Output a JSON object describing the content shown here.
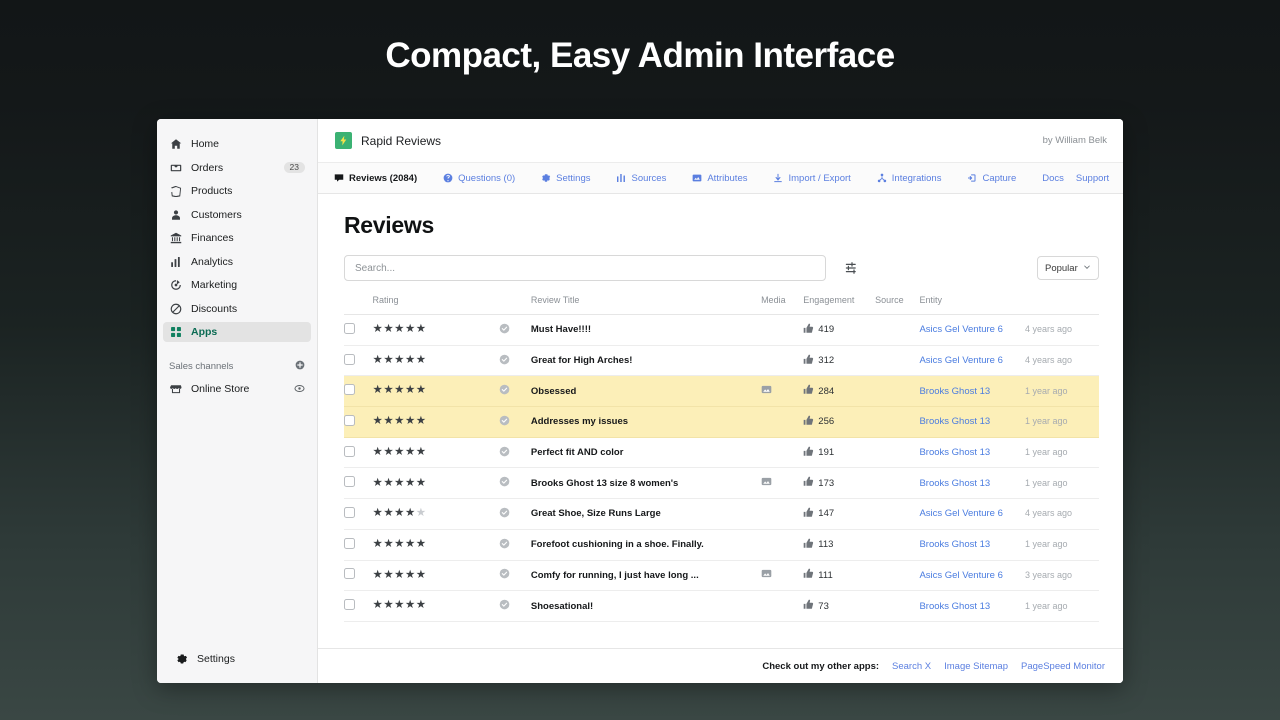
{
  "banner": {
    "title": "Compact, Easy Admin Interface"
  },
  "theme": {
    "accent_green": "#108060",
    "link_blue": "#5b7fe0",
    "highlight_row": "#fcefb8",
    "sidebar_bg": "#f6f6f7",
    "page_bg_top": "#121617",
    "page_bg_bottom": "#3a4744"
  },
  "sidebar": {
    "items": [
      {
        "label": "Home",
        "icon": "home-icon",
        "badge": "",
        "active": false
      },
      {
        "label": "Orders",
        "icon": "orders-icon",
        "badge": "23",
        "active": false
      },
      {
        "label": "Products",
        "icon": "products-icon",
        "badge": "",
        "active": false
      },
      {
        "label": "Customers",
        "icon": "customers-icon",
        "badge": "",
        "active": false
      },
      {
        "label": "Finances",
        "icon": "finances-icon",
        "badge": "",
        "active": false
      },
      {
        "label": "Analytics",
        "icon": "analytics-icon",
        "badge": "",
        "active": false
      },
      {
        "label": "Marketing",
        "icon": "marketing-icon",
        "badge": "",
        "active": false
      },
      {
        "label": "Discounts",
        "icon": "discounts-icon",
        "badge": "",
        "active": false
      },
      {
        "label": "Apps",
        "icon": "apps-icon",
        "badge": "",
        "active": true
      }
    ],
    "sales_channels_label": "Sales channels",
    "online_store_label": "Online Store",
    "settings_label": "Settings"
  },
  "topbar": {
    "app_name": "Rapid Reviews",
    "byline": "by William Belk"
  },
  "tabs": [
    {
      "label": "Reviews (2084)",
      "icon": "reviews-icon",
      "active": true
    },
    {
      "label": "Questions (0)",
      "icon": "question-icon",
      "active": false
    },
    {
      "label": "Settings",
      "icon": "gear-icon",
      "active": false
    },
    {
      "label": "Sources",
      "icon": "sources-icon",
      "active": false
    },
    {
      "label": "Attributes",
      "icon": "attributes-icon",
      "active": false
    },
    {
      "label": "Import / Export",
      "icon": "download-icon",
      "active": false
    },
    {
      "label": "Integrations",
      "icon": "integrations-icon",
      "active": false
    },
    {
      "label": "Capture",
      "icon": "capture-icon",
      "active": false
    },
    {
      "label": "Docs",
      "icon": "",
      "active": false
    },
    {
      "label": "Support",
      "icon": "",
      "active": false
    }
  ],
  "main": {
    "page_title": "Reviews",
    "search": {
      "value": "",
      "placeholder": "Search..."
    },
    "sort": {
      "selected": "Popular"
    },
    "table": {
      "headers": [
        "",
        "Rating",
        "",
        "Review Title",
        "Media",
        "Engagement",
        "Source",
        "Entity",
        ""
      ],
      "rows": [
        {
          "rating": 5,
          "verified": true,
          "title": "Must Have!!!!",
          "media": false,
          "engagement": "419",
          "source": "",
          "entity": "Asics Gel Venture 6",
          "time": "4 years ago",
          "highlighted": false
        },
        {
          "rating": 5,
          "verified": true,
          "title": "Great for High Arches!",
          "media": false,
          "engagement": "312",
          "source": "",
          "entity": "Asics Gel Venture 6",
          "time": "4 years ago",
          "highlighted": false
        },
        {
          "rating": 5,
          "verified": true,
          "title": "Obsessed",
          "media": true,
          "engagement": "284",
          "source": "",
          "entity": "Brooks Ghost 13",
          "time": "1 year ago",
          "highlighted": true
        },
        {
          "rating": 5,
          "verified": true,
          "title": "Addresses my issues",
          "media": false,
          "engagement": "256",
          "source": "",
          "entity": "Brooks Ghost 13",
          "time": "1 year ago",
          "highlighted": true
        },
        {
          "rating": 5,
          "verified": true,
          "title": "Perfect fit AND color",
          "media": false,
          "engagement": "191",
          "source": "",
          "entity": "Brooks Ghost 13",
          "time": "1 year ago",
          "highlighted": false
        },
        {
          "rating": 5,
          "verified": true,
          "title": "Brooks Ghost 13 size 8 women's",
          "media": true,
          "engagement": "173",
          "source": "",
          "entity": "Brooks Ghost 13",
          "time": "1 year ago",
          "highlighted": false
        },
        {
          "rating": 4,
          "verified": true,
          "title": "Great Shoe, Size Runs Large",
          "media": false,
          "engagement": "147",
          "source": "",
          "entity": "Asics Gel Venture 6",
          "time": "4 years ago",
          "highlighted": false
        },
        {
          "rating": 5,
          "verified": true,
          "title": "Forefoot cushioning in a shoe. Finally.",
          "media": false,
          "engagement": "113",
          "source": "",
          "entity": "Brooks Ghost 13",
          "time": "1 year ago",
          "highlighted": false
        },
        {
          "rating": 5,
          "verified": true,
          "title": "Comfy for running, I just have long ...",
          "media": true,
          "engagement": "111",
          "source": "",
          "entity": "Asics Gel Venture 6",
          "time": "3 years ago",
          "highlighted": false
        },
        {
          "rating": 5,
          "verified": true,
          "title": "Shoesational!",
          "media": false,
          "engagement": "73",
          "source": "",
          "entity": "Brooks Ghost 13",
          "time": "1 year ago",
          "highlighted": false
        }
      ]
    }
  },
  "footer": {
    "label": "Check out my other apps:",
    "links": [
      "Search X",
      "Image Sitemap",
      "PageSpeed Monitor"
    ]
  }
}
